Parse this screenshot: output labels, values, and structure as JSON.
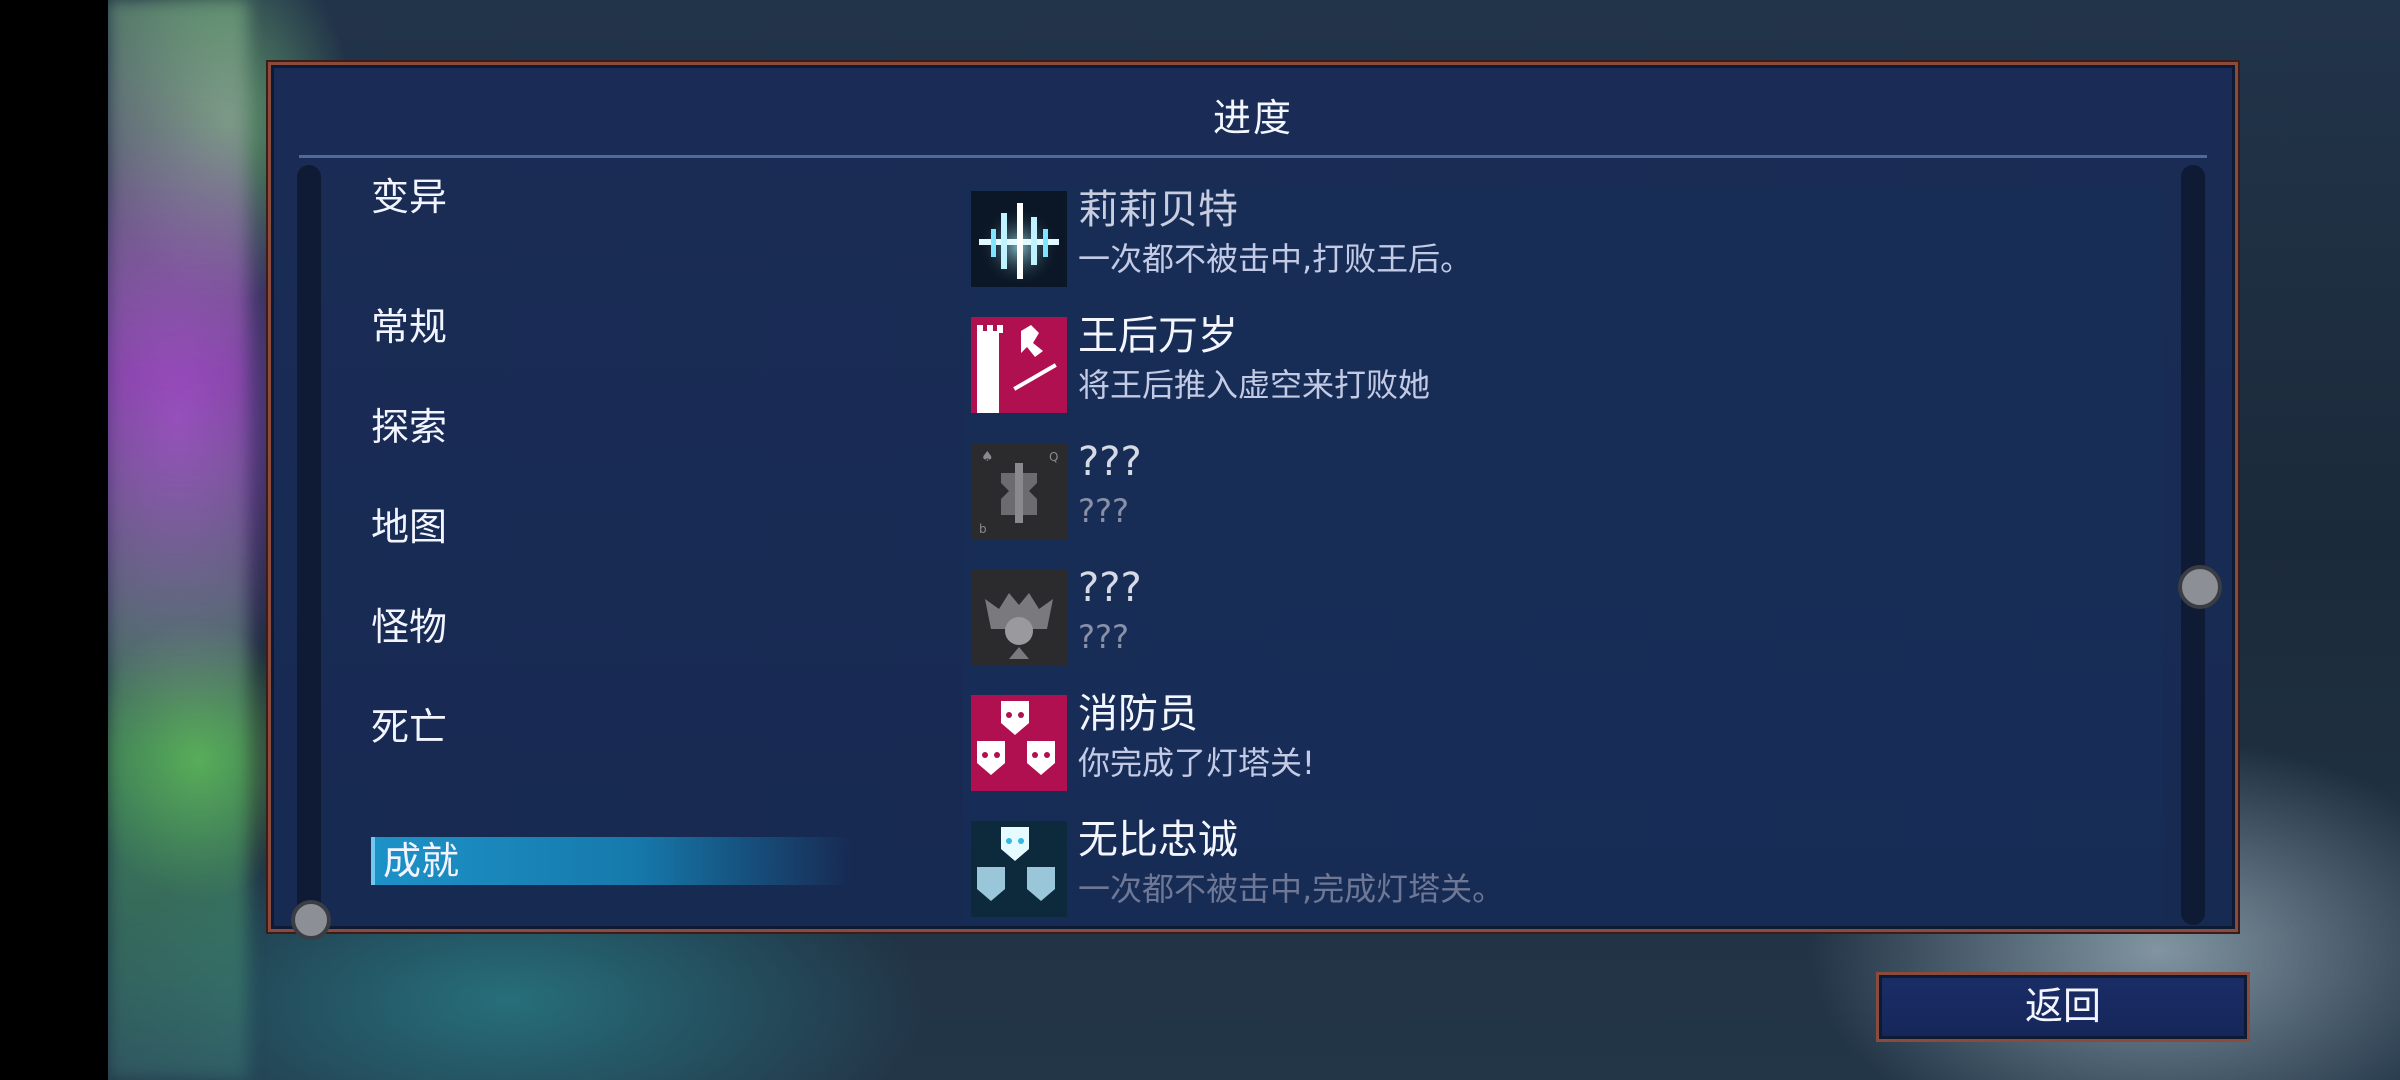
{
  "panel": {
    "title": "进度"
  },
  "categories": [
    {
      "label": "变异",
      "active": false
    },
    {
      "label": "常规",
      "active": false
    },
    {
      "label": "探索",
      "active": false
    },
    {
      "label": "地图",
      "active": false
    },
    {
      "label": "怪物",
      "active": false
    },
    {
      "label": "死亡",
      "active": false
    },
    {
      "label": "成就",
      "active": true
    }
  ],
  "achievements": [
    {
      "name": "莉莉贝特",
      "description": "一次都不被击中,打败王后。",
      "icon": "blue-sound-wave-icon",
      "locked": false
    },
    {
      "name": "王后万岁",
      "description": "将王后推入虚空来打败她",
      "icon": "magenta-tower-queen-icon",
      "locked": false
    },
    {
      "name": "???",
      "description": "???",
      "icon": "locked-queen-card-icon",
      "locked": true
    },
    {
      "name": "???",
      "description": "???",
      "icon": "locked-crown-crest-icon",
      "locked": true
    },
    {
      "name": "消防员",
      "description": "你完成了灯塔关!",
      "icon": "magenta-masks-icon",
      "locked": false
    },
    {
      "name": "无比忠诚",
      "description": "一次都不被击中,完成灯塔关。",
      "icon": "blue-masks-icon",
      "locked": false
    }
  ],
  "buttons": {
    "return_label": "返回"
  },
  "colors": {
    "panel_bg": "#1a2c55",
    "border": "#8a4a3c",
    "active_tab": "#1d92c8",
    "accent_magenta": "#c0105a",
    "accent_blue": "#37c8f0"
  }
}
